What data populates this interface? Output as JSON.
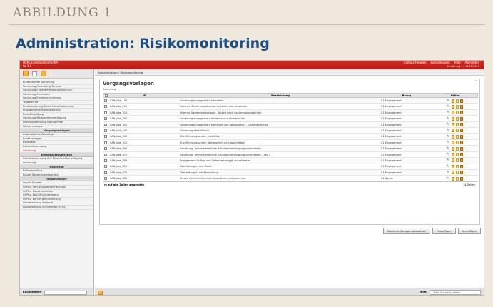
{
  "figure": {
    "label": "ABBILDUNG 1",
    "title": "Administration: Risikomonitoring"
  },
  "app": {
    "titlebar": {
      "left_line1": "OSPlus-Bestandsinfo/RM",
      "left_line2": "Sz 1.0",
      "right_items": [
        "Callbox Hinweis",
        "Einstellungen",
        "Hilfe",
        "Abmelden"
      ],
      "right_line2": "KS Admin | 1 | 18.11.2011"
    },
    "breadcrumb": "Administration / Risikomonitoring",
    "sidebar": {
      "sections": [
        {
          "type": "items",
          "items": [
            "Kreditnehmer Sanierung",
            "Sanierung Controlling Termine",
            "Sanierung Engagementkonsolidierung",
            "Sanierung Checkliste",
            "Sanierung Einzelversicherung",
            "Teilbereiche",
            "Kreditsanierung Sicherheitenbewertung",
            "Engagementkreditbewertung",
            "Bonitätsprüfung",
            "Sanierung Maßnahmenverfolgung",
            "Intensivbetreuung Maßnahmen",
            "Wiedervorlagen"
          ]
        },
        {
          "type": "head",
          "label": "Vorgangsvorlagen"
        },
        {
          "type": "items",
          "items": [
            "Automatische Workflows",
            "Kreditvorlagen",
            "Eskalation",
            "Intensivbetreuung",
            "Sanierung"
          ],
          "active_index": 4
        },
        {
          "type": "head",
          "label": "Einzelkostenvorlagen"
        },
        {
          "type": "items",
          "items": [
            "Intensivbetreuung Anl. Einzelwertberichtigung",
            "Sanierung"
          ]
        },
        {
          "type": "head",
          "label": "Reporting"
        },
        {
          "type": "items",
          "items": [
            "Risikoreporting",
            "Export Sanierungsreporting"
          ]
        },
        {
          "type": "head",
          "label": "Import/Export"
        },
        {
          "type": "items",
          "items": [
            "Import Kunden",
            "OSPlus PWS Engagement Kunden",
            "OSPlus Einzelvorstellen",
            "OSPlus EAV/SRV Unterlagen",
            "OSPlus BWV Ergebnisführung",
            "Aktualisierung Verbund",
            "Aktualisierung Sicherheiten (VVS)"
          ]
        }
      ],
      "footer": {
        "label": "Kundenfilter:",
        "value": ""
      }
    },
    "panel": {
      "title": "Vorgangsvorlagen",
      "subtitle": "Sanierung",
      "close_glyph": "˄",
      "columns": {
        "id": "ID",
        "desc": "Bezeichnung",
        "bezug": "Bezug",
        "akt": "Aktion"
      },
      "rows": [
        {
          "id": "SAN_bas_100",
          "desc": "Sanierungsengagement bewerten",
          "bezug": "01 Engagement"
        },
        {
          "id": "SAN_bas_200",
          "desc": "Internen Sanierungskonzept erstellen und umsetzen",
          "bezug": "01 Engagement"
        },
        {
          "id": "SAN_bas_210",
          "desc": "Internes Sanierungskonzept - Abzeit nach Sanierungsgutachten",
          "bezug": "01 Engagement"
        },
        {
          "id": "SAN_bas_300",
          "desc": "Sanierungsengagement bebeuen und überwachen",
          "bezug": "01 Engagement"
        },
        {
          "id": "SAN_bas_310",
          "desc": "Sanierungsengagement betreuen und überwachen - Zwischenlösung",
          "bezug": "01 Engagement"
        },
        {
          "id": "SAN_bas_400",
          "desc": "Sanierung abschließen",
          "bezug": "01 Engagement"
        },
        {
          "id": "SAN_bas_500",
          "desc": "Rückführungsrunden einstellen",
          "bezug": "01 Engagement"
        },
        {
          "id": "SAN_bas_510",
          "desc": "Rückführungsrunden überwachen und abschließen",
          "bezug": "01 Engagement"
        },
        {
          "id": "SAN_bas_600",
          "desc": "Sanierung - einvernehmliche Schuldenbereinigung veranlassen",
          "bezug": "01 Engagement"
        },
        {
          "id": "SAN_bas_610",
          "desc": "Sanierung - einvernehmliche Schuldenbereinigung veranlassen - Teil 2",
          "bezug": "01 Engagement"
        },
        {
          "id": "SAN_bas_800",
          "desc": "Engagement Erlöge und Sicherheiten ggf. aktualisieren",
          "bezug": "01 Engagement"
        },
        {
          "id": "SAN_bas_810",
          "desc": "Überleitung in den Markt",
          "bezug": "01 Engagement"
        },
        {
          "id": "SAN_bas_820",
          "desc": "Überleitung in die Abwicklung",
          "bezug": "01 Engagement"
        },
        {
          "id": "SAN_bas_830",
          "desc": "Person für Schriftwechsel auswählen und speichern",
          "bezug": "04 Kunde"
        }
      ],
      "footer_select": "auf alle Zeilen anwenden",
      "footer_count": "14 Zeilen"
    },
    "buttons": [
      "Markierte Vorlagen auswählen",
      "Hinzufügen",
      "Hinzufügen"
    ],
    "main_footer": {
      "label": "Hilfe:",
      "select_value": "- Bitte Auswahl treffen -"
    }
  }
}
